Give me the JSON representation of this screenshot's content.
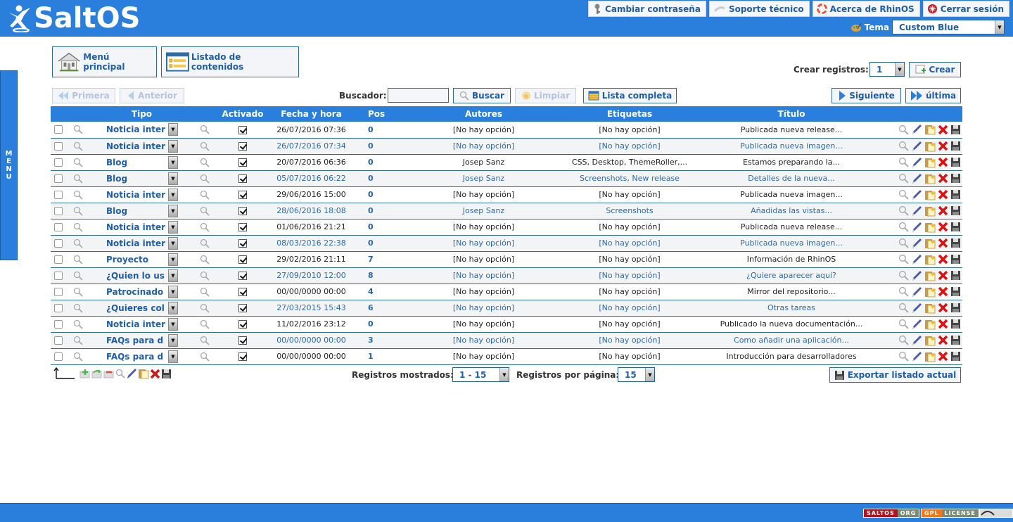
{
  "app": {
    "name": "SaltOS"
  },
  "header": {
    "buttons": [
      {
        "label": "Cambiar contraseña",
        "icon": "key-icon"
      },
      {
        "label": "Soporte técnico",
        "icon": "support-icon"
      },
      {
        "label": "Acerca de RhinOS",
        "icon": "lifebuoy-icon"
      },
      {
        "label": "Cerrar sesión",
        "icon": "power-icon"
      }
    ],
    "theme_label": "Tema",
    "theme_value": "Custom Blue"
  },
  "side_menu": {
    "letters": [
      "M",
      "E",
      "N",
      "U"
    ]
  },
  "nav": {
    "main_menu": "Menú principal",
    "content_list": "Listado de contenidos"
  },
  "create": {
    "label": "Crear registros:",
    "value": "1",
    "button": "Crear"
  },
  "pager": {
    "first": "Primera",
    "prev": "Anterior",
    "next": "Siguiente",
    "last": "última"
  },
  "search": {
    "label": "Buscador:",
    "value": "",
    "search_button": "Buscar",
    "clear_button": "Limpiar",
    "full_list_button": "Lista completa"
  },
  "table": {
    "columns": [
      "",
      "Tipo",
      "",
      "Activado",
      "Fecha y hora",
      "Pos",
      "Autores",
      "Etiquetas",
      "Título",
      ""
    ],
    "rows": [
      {
        "tipo": "Noticia inter",
        "activado": true,
        "fecha": "26/07/2016 07:36",
        "pos": "0",
        "autores": "[No hay opción]",
        "etiquetas": "[No hay opción]",
        "titulo": "Publicada nueva release..."
      },
      {
        "tipo": "Noticia inter",
        "activado": true,
        "fecha": "26/07/2016 07:34",
        "pos": "0",
        "autores": "[No hay opción]",
        "etiquetas": "[No hay opción]",
        "titulo": "Publicada nueva imagen..."
      },
      {
        "tipo": "Blog",
        "activado": true,
        "fecha": "20/07/2016 06:36",
        "pos": "0",
        "autores": "Josep Sanz",
        "etiquetas": "CSS, Desktop, ThemeRoller,...",
        "titulo": "Estamos preparando la..."
      },
      {
        "tipo": "Blog",
        "activado": true,
        "fecha": "05/07/2016 06:22",
        "pos": "0",
        "autores": "Josep Sanz",
        "etiquetas": "Screenshots, New release",
        "titulo": "Detalles de la nueva..."
      },
      {
        "tipo": "Noticia inter",
        "activado": true,
        "fecha": "29/06/2016 15:00",
        "pos": "0",
        "autores": "[No hay opción]",
        "etiquetas": "[No hay opción]",
        "titulo": "Publicada nueva imagen..."
      },
      {
        "tipo": "Blog",
        "activado": true,
        "fecha": "28/06/2016 18:08",
        "pos": "0",
        "autores": "Josep Sanz",
        "etiquetas": "Screenshots",
        "titulo": "Añadidas las vistas..."
      },
      {
        "tipo": "Noticia inter",
        "activado": true,
        "fecha": "01/06/2016 21:21",
        "pos": "0",
        "autores": "[No hay opción]",
        "etiquetas": "[No hay opción]",
        "titulo": "Publicada nueva release..."
      },
      {
        "tipo": "Noticia inter",
        "activado": true,
        "fecha": "08/03/2016 22:38",
        "pos": "0",
        "autores": "[No hay opción]",
        "etiquetas": "[No hay opción]",
        "titulo": "Publicada nueva imagen..."
      },
      {
        "tipo": "Proyecto",
        "activado": true,
        "fecha": "29/02/2016 21:11",
        "pos": "7",
        "autores": "[No hay opción]",
        "etiquetas": "[No hay opción]",
        "titulo": "Información de RhinOS"
      },
      {
        "tipo": "¿Quien lo us",
        "activado": true,
        "fecha": "27/09/2010 12:00",
        "pos": "8",
        "autores": "[No hay opción]",
        "etiquetas": "[No hay opción]",
        "titulo": "¿Quiere aparecer aquí?"
      },
      {
        "tipo": "Patrocinado",
        "activado": true,
        "fecha": "00/00/0000 00:00",
        "pos": "4",
        "autores": "[No hay opción]",
        "etiquetas": "[No hay opción]",
        "titulo": "Mirror del repositorio..."
      },
      {
        "tipo": "¿Quieres col",
        "activado": true,
        "fecha": "27/03/2015 15:43",
        "pos": "6",
        "autores": "[No hay opción]",
        "etiquetas": "[No hay opción]",
        "titulo": "Otras tareas"
      },
      {
        "tipo": "Noticia inter",
        "activado": true,
        "fecha": "11/02/2016 23:12",
        "pos": "0",
        "autores": "[No hay opción]",
        "etiquetas": "[No hay opción]",
        "titulo": "Publicado la nueva documentación..."
      },
      {
        "tipo": "FAQs para d",
        "activado": true,
        "fecha": "00/00/0000 00:00",
        "pos": "3",
        "autores": "[No hay opción]",
        "etiquetas": "[No hay opción]",
        "titulo": "Como añadir una aplicación..."
      },
      {
        "tipo": "FAQs para d",
        "activado": true,
        "fecha": "00/00/0000 00:00",
        "pos": "1",
        "autores": "[No hay opción]",
        "etiquetas": "[No hay opción]",
        "titulo": "Introducción para desarrolladores"
      }
    ]
  },
  "footer_bar": {
    "shown_label": "Registros mostrados:",
    "shown_value": "1 - 15",
    "per_page_label": "Registros por página:",
    "per_page_value": "15",
    "export_button": "Exportar listado actual"
  },
  "footer": {
    "badges": [
      {
        "left": "SALTOS",
        "right": "ORG",
        "left_color": "#b5121b",
        "right_color": "#7c8a76"
      },
      {
        "left": "GPL",
        "right": "LICENSE",
        "left_color": "#f07818",
        "right_color": "#7c8a76"
      }
    ]
  },
  "colors": {
    "accent": "#2a7fdd",
    "link": "#1f5ea8"
  }
}
